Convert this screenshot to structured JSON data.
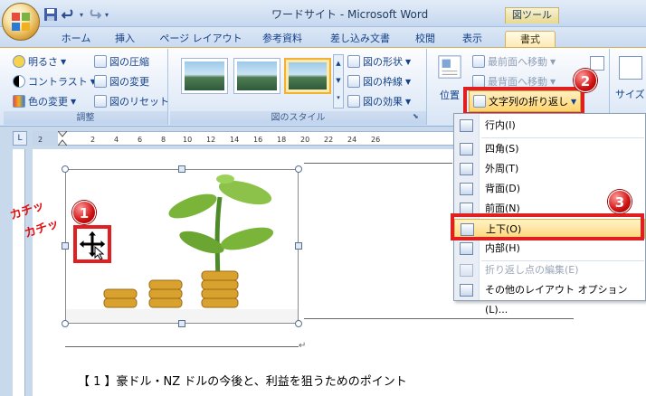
{
  "window": {
    "title": "ワードサイト - Microsoft Word",
    "contextual_tab_group": "図ツール"
  },
  "tabs": [
    {
      "label": "ホーム"
    },
    {
      "label": "挿入"
    },
    {
      "label": "ページ レイアウト"
    },
    {
      "label": "参考資料"
    },
    {
      "label": "差し込み文書"
    },
    {
      "label": "校閲"
    },
    {
      "label": "表示"
    },
    {
      "label": "書式"
    }
  ],
  "active_tab": "書式",
  "ribbon": {
    "adjust": {
      "label": "調整",
      "brightness": "明るさ",
      "contrast": "コントラスト",
      "recolor": "色の変更",
      "compress": "図の圧縮",
      "change_picture": "図の変更",
      "reset_picture": "図のリセット"
    },
    "styles": {
      "label": "図のスタイル",
      "shape": "図の形状",
      "border": "図の枠線",
      "effects": "図の効果"
    },
    "arrange": {
      "bring_front": "最前面へ移動",
      "send_back": "最背面へ移動",
      "position": "位置",
      "wrap_text": "文字列の折り返し"
    },
    "size": {
      "label": "サイズ"
    }
  },
  "wrap_menu": {
    "items": [
      {
        "label": "行内(I)",
        "icon": "inline-icon",
        "enabled": true
      },
      {
        "label": "四角(S)",
        "icon": "square-wrap-icon",
        "enabled": true
      },
      {
        "label": "外周(T)",
        "icon": "tight-wrap-icon",
        "enabled": true
      },
      {
        "label": "背面(D)",
        "icon": "behind-text-icon",
        "enabled": true
      },
      {
        "label": "前面(N)",
        "icon": "front-text-icon",
        "enabled": true
      },
      {
        "label": "上下(O)",
        "icon": "top-bottom-icon",
        "enabled": true,
        "highlighted": true
      },
      {
        "label": "内部(H)",
        "icon": "through-icon",
        "enabled": true
      },
      {
        "label": "折り返し点の編集(E)",
        "icon": "edit-wrap-points-icon",
        "enabled": false
      },
      {
        "label": "その他のレイアウト オプション(L)...",
        "icon": "layout-options-icon",
        "enabled": true
      }
    ]
  },
  "ruler": {
    "numbers": [
      "2",
      "2",
      "4",
      "6",
      "8",
      "10",
      "12",
      "14",
      "16",
      "18",
      "20",
      "22",
      "24",
      "26"
    ]
  },
  "document": {
    "heading": "【 1 】豪ドル・NZ ドルの今後と、利益を狙うためのポイント"
  },
  "annotations": {
    "click_text": [
      "カチッ",
      "カチッ"
    ],
    "steps": [
      "1",
      "2",
      "3"
    ],
    "accent_color": "#e02020"
  }
}
